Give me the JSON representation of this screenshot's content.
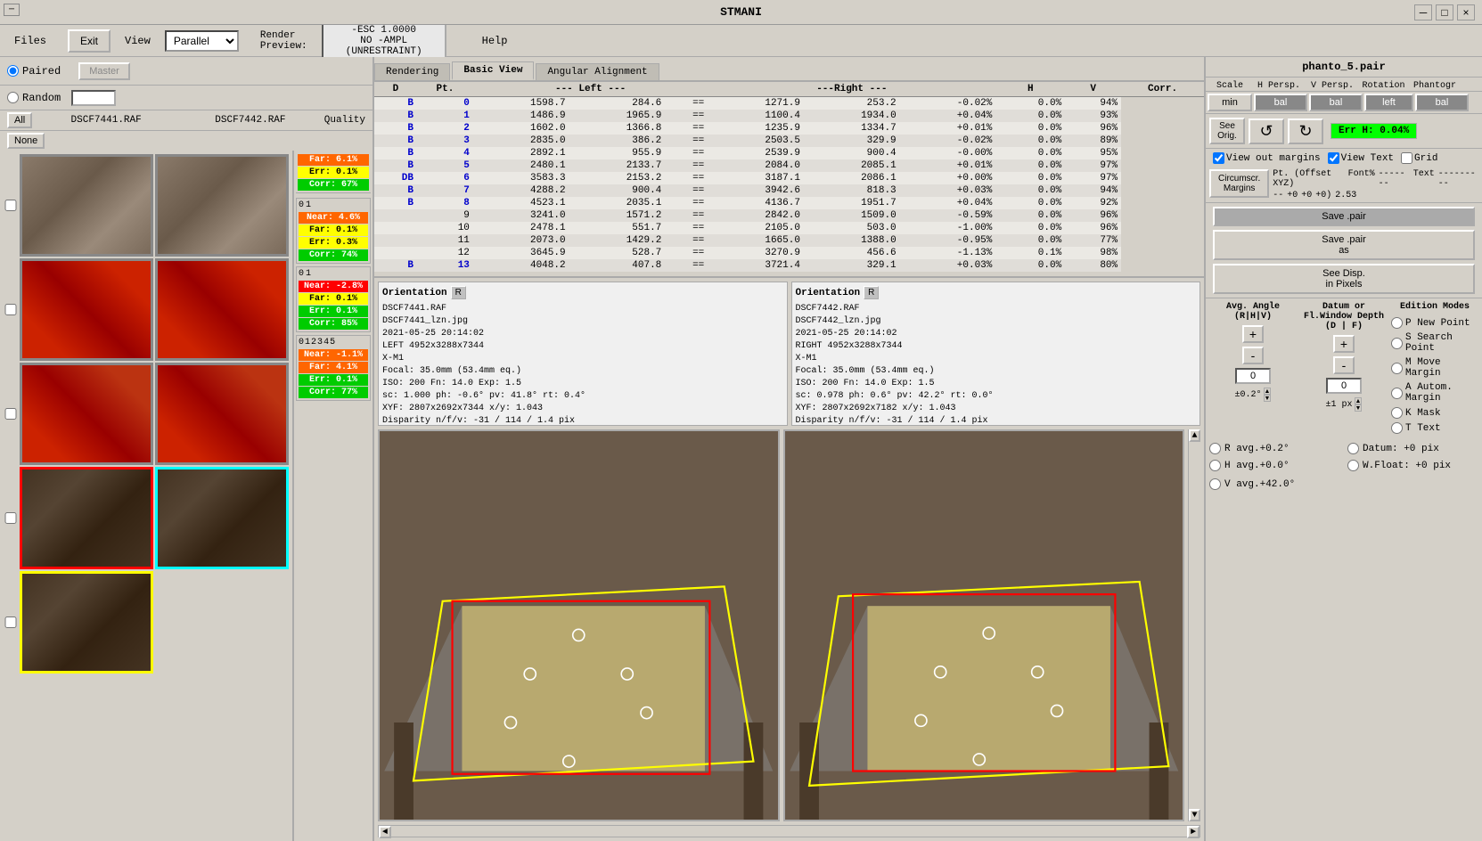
{
  "titlebar": {
    "title": "STMANI",
    "min": "─",
    "max": "□",
    "close": "×"
  },
  "menubar": {
    "files_label": "Files",
    "exit_label": "Exit",
    "view_label": "View",
    "view_value": "Parallel",
    "render_label": "Render\nPreview:",
    "esc_text": "-ESC 1.0000\nNO -AMPL\n(UNRESTRAINT)",
    "help_label": "Help"
  },
  "left_panel": {
    "paired_label": "Paired",
    "random_label": "Random",
    "master_label": "Master",
    "all_label": "All",
    "none_label": "None",
    "file1": "DSCF7441.RAF",
    "file2": "DSCF7442.RAF",
    "quality_label": "Quality",
    "stat_groups": [
      {
        "nums": [
          "0",
          "1"
        ],
        "near": "Near: 4.6%",
        "far": "Far: 0.1%",
        "err": "Err: 0.3%",
        "corr": "Corr: 74%"
      },
      {
        "nums": [
          "0",
          "1"
        ],
        "near": "Near: -2.8%",
        "far": "Far: 0.1%",
        "err": "Err: 0.1%",
        "corr": "Corr: 85%"
      },
      {
        "nums": [
          "0",
          "1",
          "2",
          "3",
          "4",
          "5"
        ],
        "near": "Near: -1.1%",
        "far": "Far: 4.1%",
        "err": "Err: 0.1%",
        "corr": "Corr: 77%"
      }
    ],
    "quality_summary": {
      "far": "Far: 6.1%",
      "err": "Err: 0.1%",
      "corr": "Corr: 67%"
    }
  },
  "center_panel": {
    "tabs": [
      "Rendering",
      "Basic View",
      "Angular Alignment"
    ],
    "active_tab": "Basic View",
    "table": {
      "headers": [
        "D",
        "Pt.",
        "--- Left ---",
        "---Right ---",
        "H",
        "V",
        "Corr."
      ],
      "rows": [
        {
          "d": "B",
          "pt": "0",
          "left1": "1598.7",
          "left2": "284.6",
          "eq": "==",
          "r1": "1271.9",
          "r2": "253.2",
          "h": "-0.02%",
          "v": "0.0%",
          "corr": "94%"
        },
        {
          "d": "B",
          "pt": "1",
          "left1": "1486.9",
          "left2": "1965.9",
          "eq": "==",
          "r1": "1100.4",
          "r2": "1934.0",
          "h": "+0.04%",
          "v": "0.0%",
          "corr": "93%"
        },
        {
          "d": "B",
          "pt": "2",
          "left1": "1602.0",
          "left2": "1366.8",
          "eq": "==",
          "r1": "1235.9",
          "r2": "1334.7",
          "h": "+0.01%",
          "v": "0.0%",
          "corr": "96%"
        },
        {
          "d": "B",
          "pt": "3",
          "left1": "2835.0",
          "left2": "386.2",
          "eq": "==",
          "r1": "2503.5",
          "r2": "329.9",
          "h": "-0.02%",
          "v": "0.0%",
          "corr": "89%"
        },
        {
          "d": "B",
          "pt": "4",
          "left1": "2892.1",
          "left2": "955.9",
          "eq": "==",
          "r1": "2539.9",
          "r2": "900.4",
          "h": "-0.00%",
          "v": "0.0%",
          "corr": "95%"
        },
        {
          "d": "B",
          "pt": "5",
          "left1": "2480.1",
          "left2": "2133.7",
          "eq": "==",
          "r1": "2084.0",
          "r2": "2085.1",
          "h": "+0.01%",
          "v": "0.0%",
          "corr": "97%"
        },
        {
          "d": "DB",
          "pt": "6",
          "left1": "3583.3",
          "left2": "2153.2",
          "eq": "==",
          "r1": "3187.1",
          "r2": "2086.1",
          "h": "+0.00%",
          "v": "0.0%",
          "corr": "97%"
        },
        {
          "d": "B",
          "pt": "7",
          "left1": "4288.2",
          "left2": "900.4",
          "eq": "==",
          "r1": "3942.6",
          "r2": "818.3",
          "h": "+0.03%",
          "v": "0.0%",
          "corr": "94%"
        },
        {
          "d": "B",
          "pt": "8",
          "left1": "4523.1",
          "left2": "2035.1",
          "eq": "==",
          "r1": "4136.7",
          "r2": "1951.7",
          "h": "+0.04%",
          "v": "0.0%",
          "corr": "92%"
        },
        {
          "d": "",
          "pt": "9",
          "left1": "3241.0",
          "left2": "1571.2",
          "eq": "==",
          "r1": "2842.0",
          "r2": "1509.0",
          "h": "-0.59%",
          "v": "0.0%",
          "corr": "96%"
        },
        {
          "d": "",
          "pt": "10",
          "left1": "2478.1",
          "left2": "551.7",
          "eq": "==",
          "r1": "2105.0",
          "r2": "503.0",
          "h": "-1.00%",
          "v": "0.0%",
          "corr": "96%"
        },
        {
          "d": "",
          "pt": "11",
          "left1": "2073.0",
          "left2": "1429.2",
          "eq": "==",
          "r1": "1665.0",
          "r2": "1388.0",
          "h": "-0.95%",
          "v": "0.0%",
          "corr": "77%"
        },
        {
          "d": "",
          "pt": "12",
          "left1": "3645.9",
          "left2": "528.7",
          "eq": "==",
          "r1": "3270.9",
          "r2": "456.6",
          "h": "-1.13%",
          "v": "0.1%",
          "corr": "98%"
        },
        {
          "d": "B",
          "pt": "13",
          "left1": "4048.2",
          "left2": "407.8",
          "eq": "==",
          "r1": "3721.4",
          "r2": "329.1",
          "h": "+0.03%",
          "v": "0.0%",
          "corr": "80%"
        }
      ]
    },
    "orientation_left": {
      "title": "Orientation",
      "r_label": "R",
      "file": "DSCF7441.RAF",
      "jpg": "DSCF7441_lzn.jpg",
      "date": "2021-05-25 20:14:02",
      "side": "LEFT",
      "res": "4952x3288x7344",
      "cam": "X-M1",
      "focal": "Focal: 35.0mm (53.4mm eq.)",
      "iso": "ISO: 200  Fn: 14.0  Exp: 1.5",
      "sc": "sc: 1.000  ph: -0.6°  pv: 41.8°  rt: 0.4°",
      "xyz": "XYF: 2807x2692x7344  x/y: 1.043",
      "disp": "Disparity n/f/v: -31 / 114 / 1.4  pix"
    },
    "orientation_right": {
      "title": "Orientation",
      "r_label": "R",
      "file": "DSCF7442.RAF",
      "jpg": "DSCF7442_lzn.jpg",
      "date": "2021-05-25 20:14:02",
      "side": "RIGHT",
      "res": "4952x3288x7344",
      "cam": "X-M1",
      "focal": "Focal: 35.0mm (53.4mm eq.)",
      "iso": "ISO: 200  Fn: 14.0  Exp: 1.5",
      "sc": "sc: 0.978  ph: 0.6°  pv: 42.2°  rt: 0.0°",
      "xyz": "XYF: 2807x2692x7182  x/y: 1.043",
      "disp": "Disparity n/f/v: -31 / 114 / 1.4  pix"
    }
  },
  "right_panel": {
    "filename": "phanto_5.pair",
    "scale_label": "Scale",
    "h_persp_label": "H Persp.",
    "v_persp_label": "V Persp.",
    "rotation_label": "Rotation",
    "phantogr_label": "Phantogr",
    "min_label": "min",
    "bal_labels": [
      "bal",
      "bal",
      "left",
      "bal"
    ],
    "see_orig_label": "See\nOrig.",
    "rotate_left_label": "↺",
    "rotate_cw_label": "↻",
    "err_h": "Err H: 0.04%",
    "view_out_margins": "View out margins",
    "view_text": "View Text",
    "grid_label": "Grid",
    "circumscr_label": "Circumscr.\nMargins",
    "pt_offset_label": "Pt. (Offset XYZ)",
    "font_pct_label": "Font%",
    "text_label": "Text",
    "save_pair_label": "Save .pair",
    "save_pair_as_label": "Save .pair\nas",
    "see_disp_label": "See Disp.\nin Pixels",
    "avg_angle_label": "Avg.\nAngle\n(R|H|V)",
    "datum_label": "Datum or\nFl.Window\nDepth\n(D | F)",
    "edition_label": "Edition\nModes",
    "plus_label": "+",
    "minus_label": "-",
    "zero_label": "0",
    "pm_angle": "±0.2°",
    "pm_px": "±1 px",
    "p_new_point": "P New\nPoint",
    "s_search_point": "S Search\nPoint",
    "m_move_margin": "M Move\nMargin",
    "a_autom_margin": "A Autom.\nMargin",
    "k_mask": "K Mask",
    "t_text": "T Text",
    "r_avg": "R avg.+0.2°",
    "h_avg": "H avg.+0.0°",
    "datum_px": "Datum:  +0 pix",
    "w_float": "W.Float:  +0 pix",
    "v_avg": "V avg.+42.0°"
  }
}
